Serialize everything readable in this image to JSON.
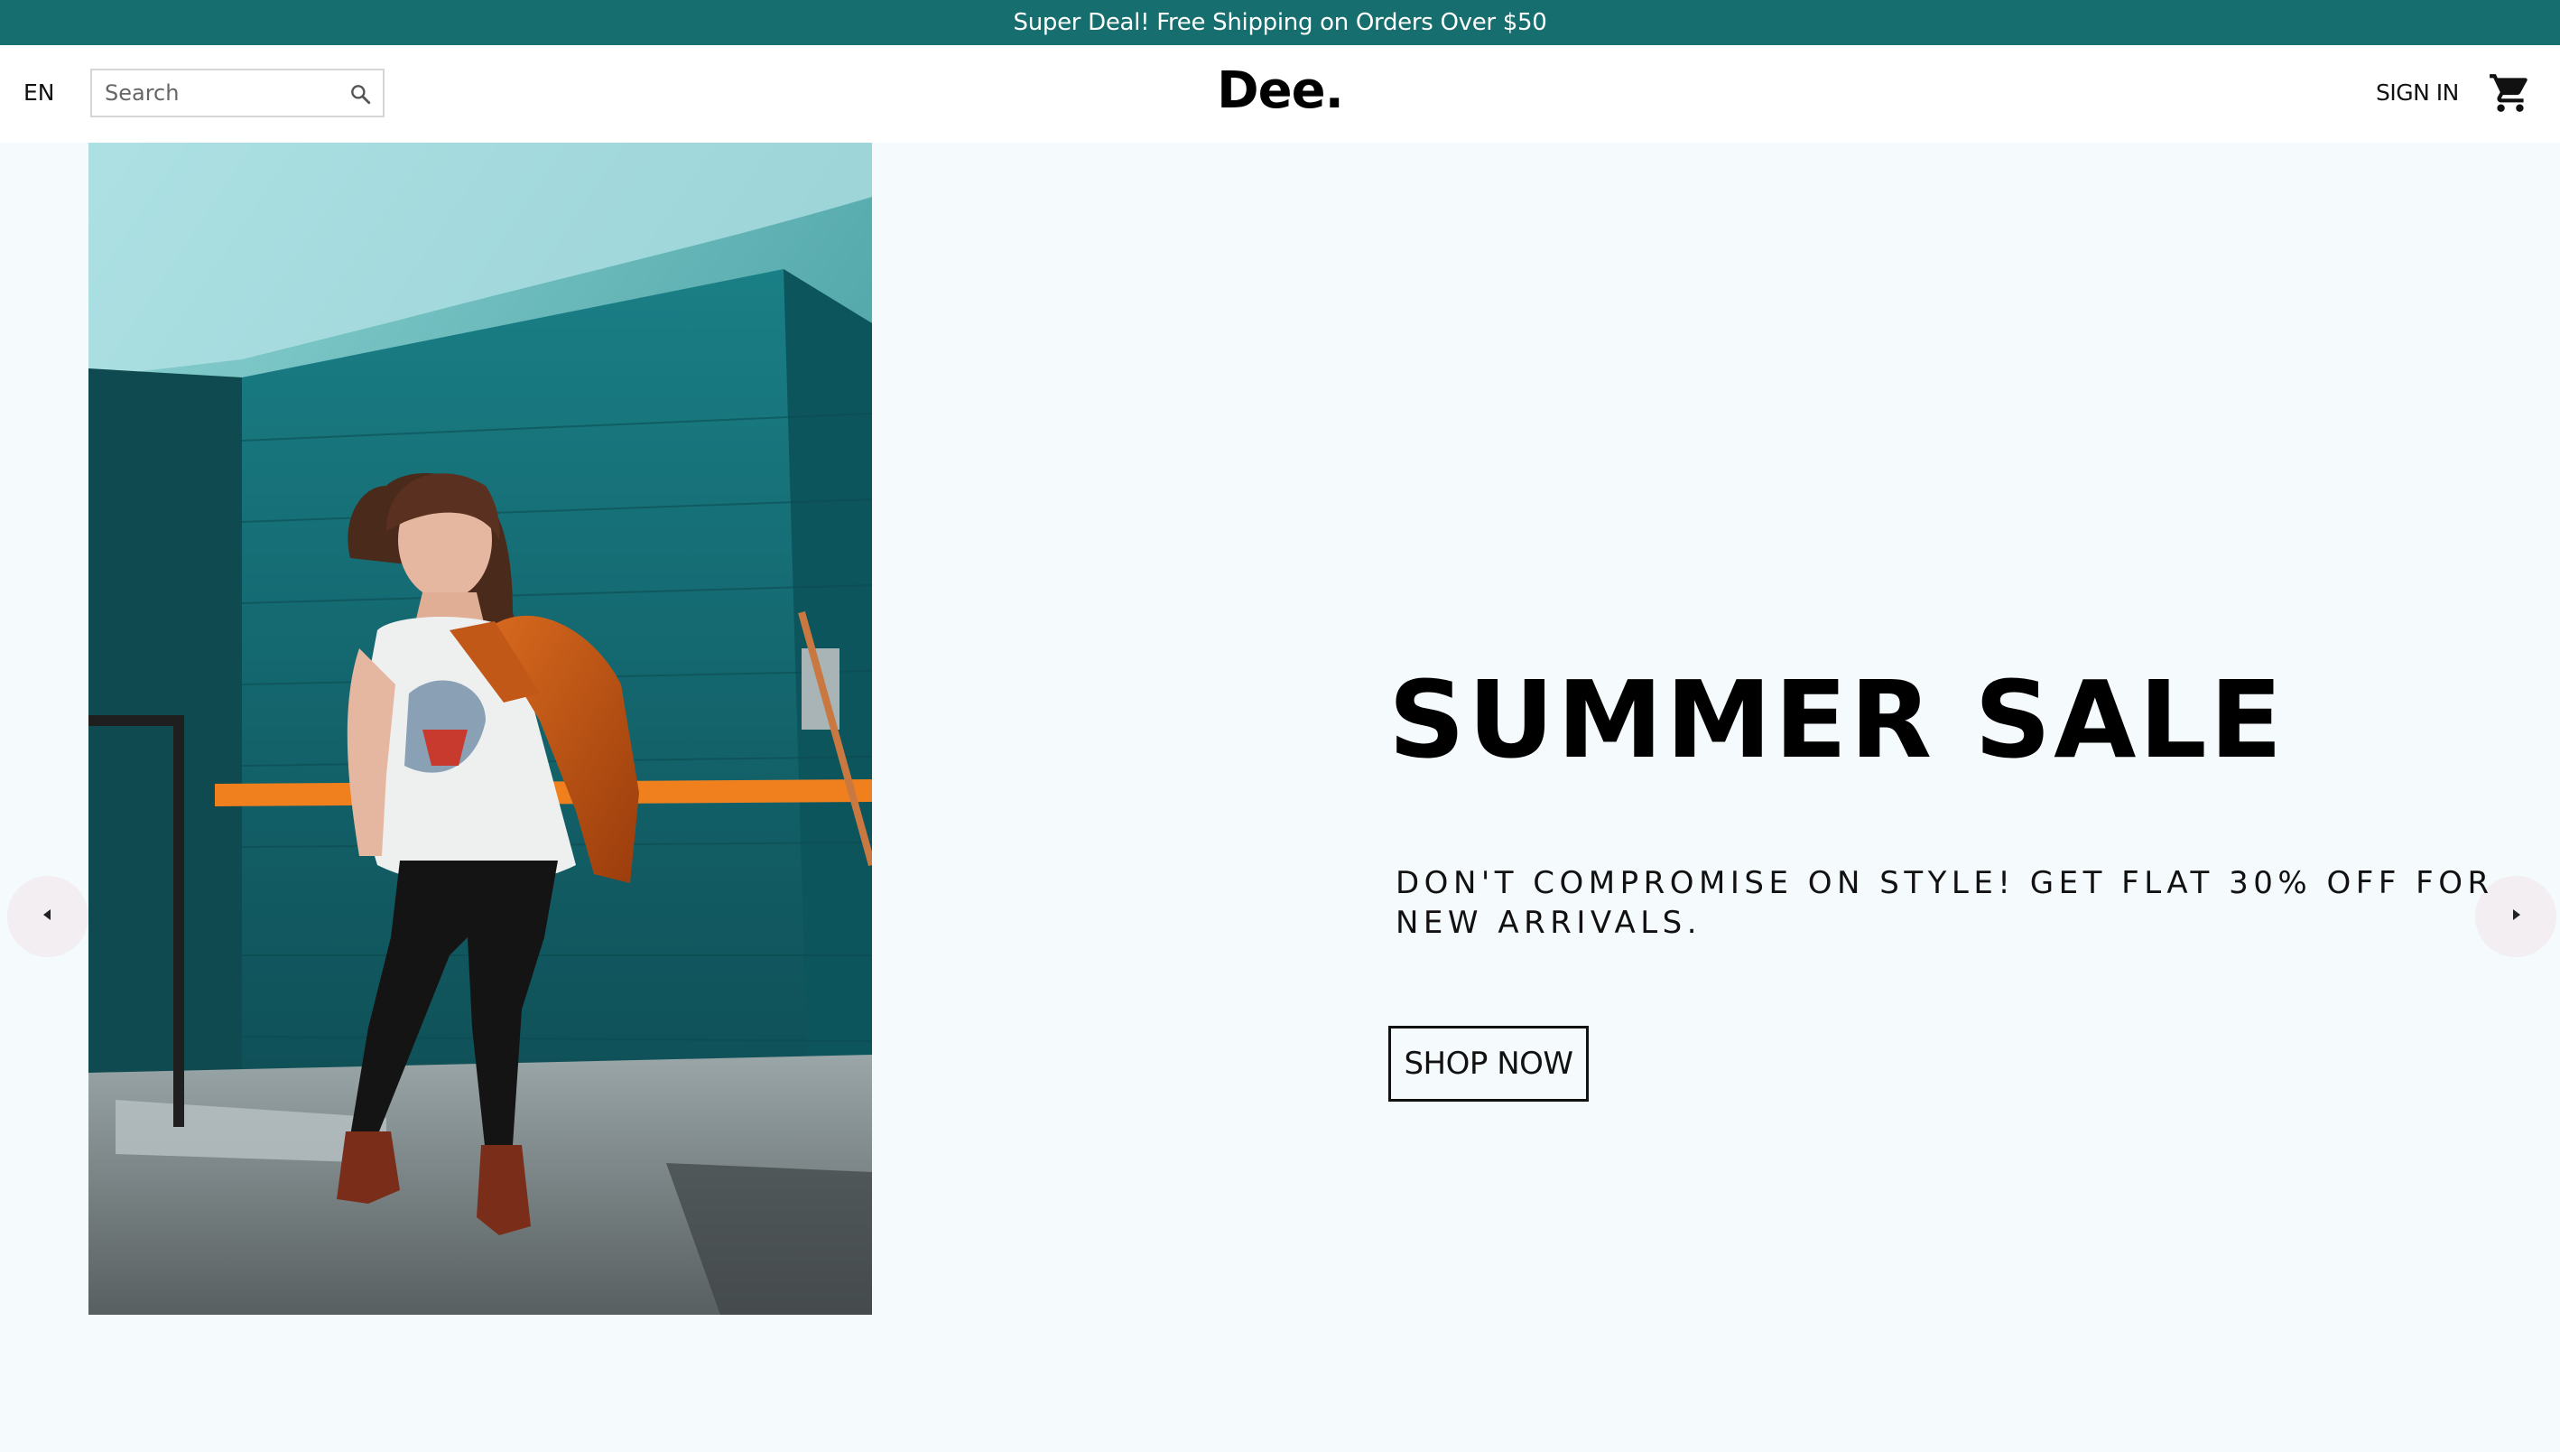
{
  "announcement": {
    "text": "Super Deal! Free Shipping on Orders Over $50"
  },
  "navbar": {
    "language": "EN",
    "search": {
      "placeholder": "Search",
      "value": ""
    },
    "logo": "Dee.",
    "signin": "SIGN IN"
  },
  "hero": {
    "title": "SUMMER SALE",
    "description": "DON'T COMPROMISE ON STYLE! GET FLAT 30% OFF FOR NEW ARRIVALS.",
    "cta": "SHOP NOW"
  },
  "colors": {
    "announcement_bg": "#176e6e",
    "page_bg": "#f5fafd",
    "text": "#111111"
  },
  "icons": [
    "search-icon",
    "shopping-cart-icon",
    "chevron-left-icon",
    "chevron-right-icon"
  ]
}
